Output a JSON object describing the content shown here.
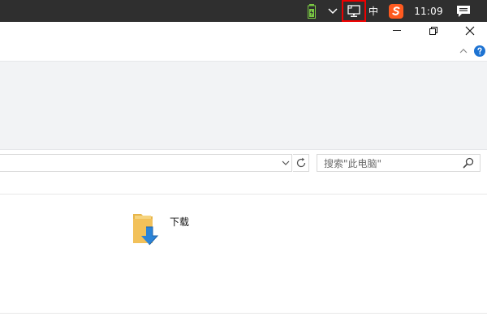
{
  "taskbar": {
    "tray": {
      "ime_char": "中",
      "clock": "11:09"
    }
  },
  "window": {
    "search": {
      "placeholder": "搜索\"此电脑\""
    },
    "content": {
      "items": [
        {
          "label": "下载"
        }
      ]
    }
  },
  "colors": {
    "taskbar_bg": "#2f2f2f",
    "highlight_border": "#e00000",
    "help_blue": "#1e73d2",
    "folder_yellow": "#f2c15a",
    "download_blue": "#2b84d8"
  }
}
